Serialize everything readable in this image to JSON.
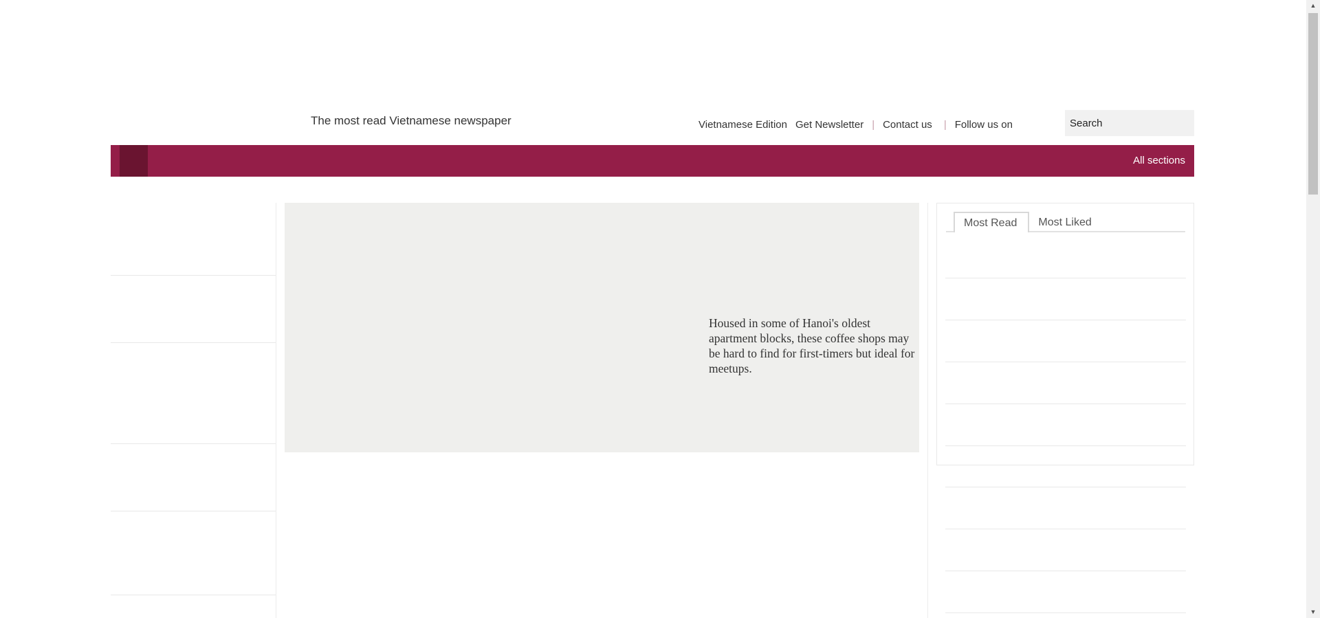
{
  "header": {
    "tagline": "The most read Vietnamese newspaper",
    "nav": {
      "vietnamese_edition": "Vietnamese Edition",
      "newsletter": "Get Newsletter",
      "contact": "Contact us",
      "follow": "Follow us on",
      "separator": "|"
    },
    "search": {
      "placeholder": "Search"
    }
  },
  "menubar": {
    "all_sections": "All sections",
    "brand_color": "#941e48"
  },
  "hero": {
    "description": "Housed in some of Hanoi's oldest apartment blocks, these coffee shops may be hard to find for first-timers but ideal for meetups."
  },
  "sidebar": {
    "tabs": [
      {
        "label": "Most Read",
        "active": true
      },
      {
        "label": "Most Liked",
        "active": false
      }
    ]
  },
  "scrollbar": {
    "up_icon": "▲",
    "down_icon": "▼"
  }
}
